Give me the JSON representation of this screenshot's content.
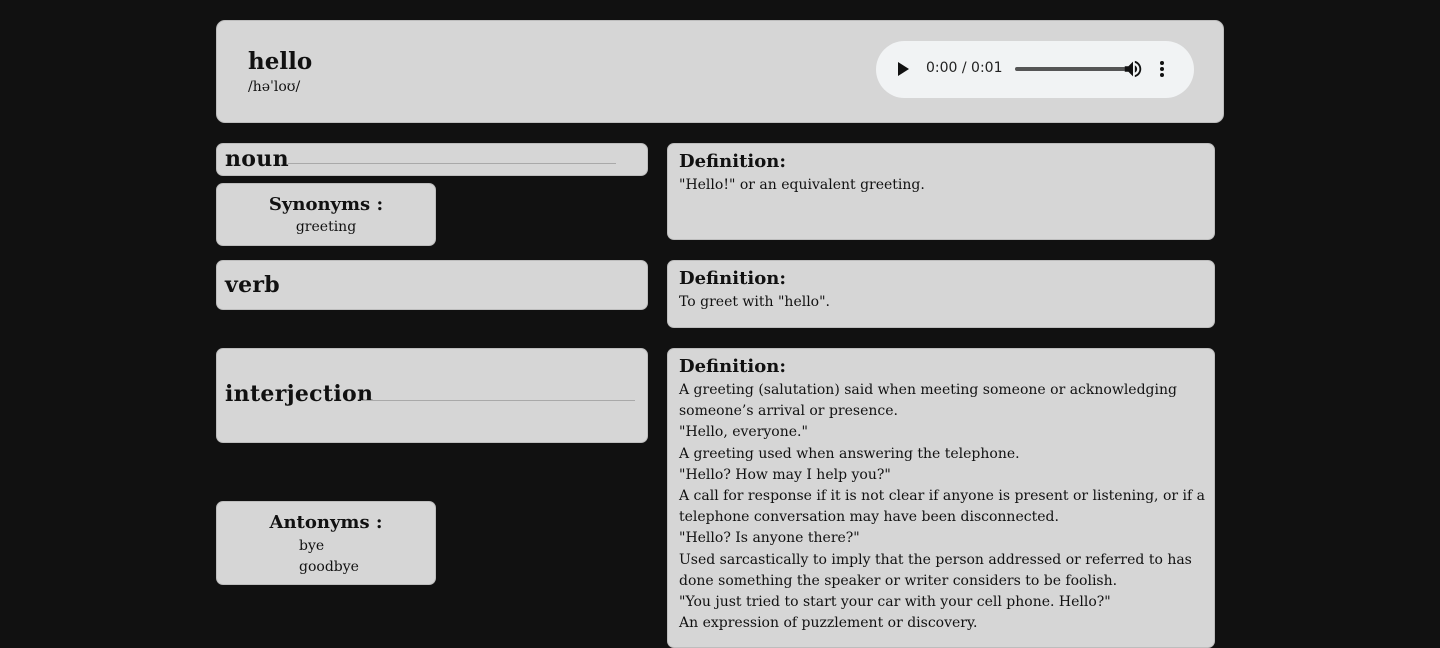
{
  "word": {
    "text": "hello",
    "phonetic": "/həˈloʊ/"
  },
  "audio_player": {
    "time": "0:00 / 0:01",
    "progress": 0
  },
  "meanings": {
    "noun": {
      "part_of_speech": "noun",
      "synonyms_label": "Synonyms :",
      "synonyms": [
        "greeting"
      ],
      "definition_label": "Definition:",
      "definitions": [
        "\"Hello!\" or an equivalent greeting."
      ]
    },
    "verb": {
      "part_of_speech": "verb",
      "definition_label": "Definition:",
      "definitions": [
        "To greet with \"hello\"."
      ]
    },
    "interjection": {
      "part_of_speech": "interjection",
      "antonyms_label": "Antonyms :",
      "antonyms": [
        "bye",
        "goodbye"
      ],
      "definition_label": "Definition:",
      "definitions": [
        "A greeting (salutation) said when meeting someone or acknowledging someone’s arrival or presence.",
        "\"Hello, everyone.\"",
        "A greeting used when answering the telephone.",
        "\"Hello? How may I help you?\"",
        "A call for response if it is not clear if anyone is present or listening, or if a telephone conversation may have been disconnected.",
        "\"Hello? Is anyone there?\"",
        "Used sarcastically to imply that the person addressed or referred to has done something the speaker or writer considers to be foolish.",
        "\"You just tried to start your car with your cell phone. Hello?\"",
        "An expression of puzzlement or discovery."
      ]
    }
  }
}
